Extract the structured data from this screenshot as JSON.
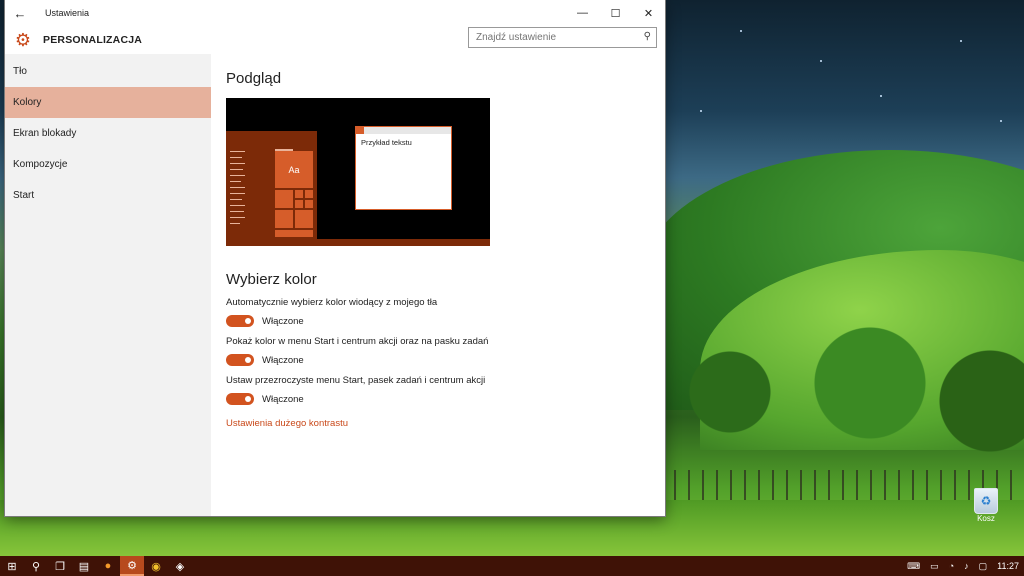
{
  "window": {
    "app_title": "Ustawienia",
    "back_icon": "←",
    "minimize_icon": "—",
    "maximize_icon": "☐",
    "close_icon": "✕"
  },
  "header": {
    "section_title": "PERSONALIZACJA",
    "search_placeholder": "Znajdź ustawienie"
  },
  "sidebar": {
    "items": [
      {
        "label": "Tło",
        "active": false
      },
      {
        "label": "Kolory",
        "active": true
      },
      {
        "label": "Ekran blokady",
        "active": false
      },
      {
        "label": "Kompozycje",
        "active": false
      },
      {
        "label": "Start",
        "active": false
      }
    ]
  },
  "content": {
    "preview_heading": "Podgląd",
    "preview_tile_text": "Aa",
    "preview_window_text": "Przykład tekstu",
    "choose_color_heading": "Wybierz kolor",
    "settings": [
      {
        "label": "Automatycznie wybierz kolor wiodący z mojego tła",
        "toggle_text": "Włączone",
        "on": true
      },
      {
        "label": "Pokaż kolor w menu Start i centrum akcji oraz na pasku zadań",
        "toggle_text": "Włączone",
        "on": true
      },
      {
        "label": "Ustaw przezroczyste menu Start, pasek zadań i centrum akcji",
        "toggle_text": "Włączone",
        "on": true
      }
    ],
    "high_contrast_link": "Ustawienia dużego kontrastu"
  },
  "desktop": {
    "recycle_bin_label": "Kosz"
  },
  "taskbar": {
    "clock": "11:27"
  },
  "colors": {
    "accent": "#d2531f",
    "accent_dark": "#7c2a08",
    "selected_nav": "#e6b19c",
    "taskbar": "#3f1206"
  }
}
